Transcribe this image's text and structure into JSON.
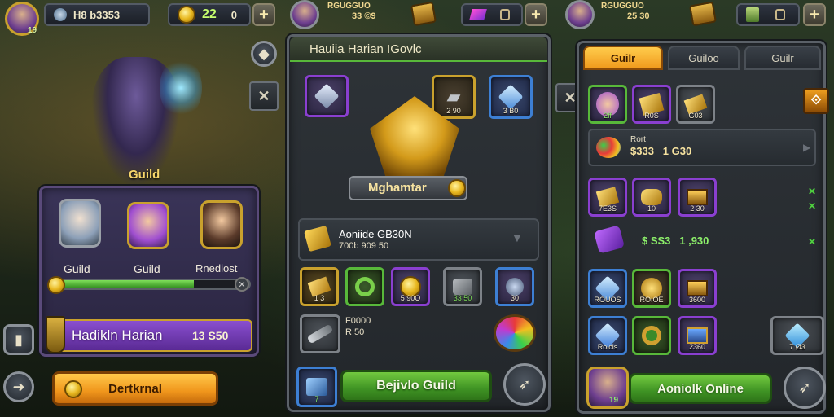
{
  "top_bar": {
    "left": {
      "level": "19",
      "currency_value": "H8 b3353",
      "coins_value": "22",
      "coins_secondary": "0"
    },
    "middle": {
      "currency_title": "RGUGGUO",
      "currency_value": "33 ©9"
    },
    "right": {
      "currency_title": "RGUGGUO",
      "currency_value": "25 30"
    }
  },
  "left_scene": {
    "hero_label": "Guild",
    "members": [
      {
        "name": "Guild"
      },
      {
        "name": "Guild"
      },
      {
        "name": "Rnediost"
      }
    ],
    "progress": 0.72,
    "banner_name": "Hadikln Harian",
    "banner_value": "13 S50",
    "action_button": "Dertkrnal"
  },
  "middle_panel": {
    "title": "Hauiia Harian IGovlc",
    "top_items": [
      {
        "caption": ""
      },
      {
        "caption": "2 90"
      },
      {
        "caption": "3 B0"
      }
    ],
    "emblem_name": "Mghamtar",
    "reward": {
      "title": "Aoniide GB30N",
      "detail": "700b 909 50"
    },
    "slots_row": [
      {
        "caption": "1 3"
      },
      {
        "caption": ""
      },
      {
        "caption": "5 90O"
      },
      {
        "caption": "33 50"
      },
      {
        "caption": "30"
      }
    ],
    "item_info": {
      "title": "F0000",
      "line2": "R 50"
    },
    "action_button": "Bejivlo Guild",
    "action_badge": "7"
  },
  "right_panel": {
    "tabs": [
      "Guilr",
      "Guiloo",
      "Guilr"
    ],
    "active_tab": 0,
    "row1": [
      {
        "caption": "2ff"
      },
      {
        "caption": "R0S"
      },
      {
        "caption": "G03"
      }
    ],
    "row2": {
      "label": "Rort",
      "values": "$333   1 G30"
    },
    "row3": [
      {
        "caption": "7E3S"
      },
      {
        "caption": "10"
      },
      {
        "caption": "2 30"
      }
    ],
    "row4": {
      "values": "$ SS3   1 ,930"
    },
    "row5": [
      {
        "caption": "ROUOS"
      },
      {
        "caption": "ROIOE"
      },
      {
        "caption": "3600"
      }
    ],
    "row6": [
      {
        "caption": "Roicis"
      },
      {
        "caption": ""
      },
      {
        "caption": "2360"
      }
    ],
    "floating_item": {
      "caption": "7 Ø3"
    },
    "action_button": "Aoniolk Online",
    "avatar_level": "19"
  }
}
